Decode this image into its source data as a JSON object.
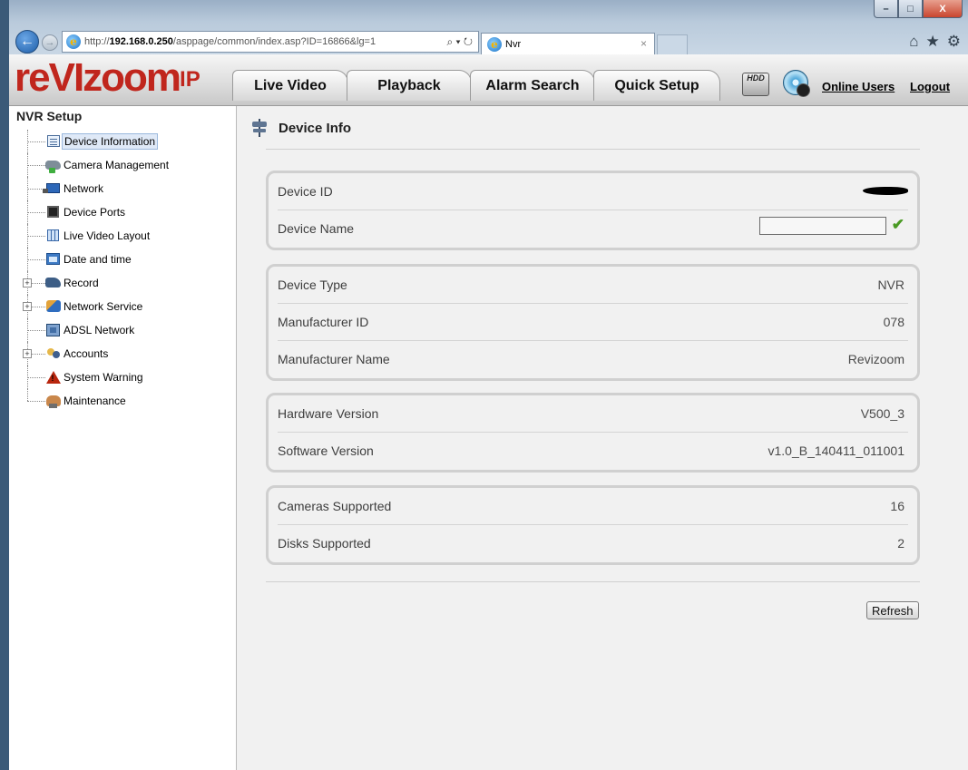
{
  "browser": {
    "url_scheme": "http://",
    "url_host": "192.168.0.250",
    "url_path": "/asppage/common/index.asp?ID=16866&lg=1",
    "addr_tools": "⌕ ▾ ↻",
    "tab_title": "Nvr",
    "tab_close": "×",
    "min_glyph": "–",
    "max_glyph": "□",
    "close_glyph": "X",
    "home_icon": "⌂",
    "star_icon": "★",
    "gear_icon": "⚙"
  },
  "app": {
    "logo_main": "reVIzoom",
    "logo_suffix": "IP",
    "tabs": [
      {
        "label": "Live Video"
      },
      {
        "label": "Playback"
      },
      {
        "label": "Alarm Search"
      },
      {
        "label": "Quick Setup"
      }
    ],
    "hdd_label": "HDD",
    "online_users": "Online Users",
    "logout": "Logout"
  },
  "sidebar": {
    "title": "NVR Setup",
    "items": [
      {
        "label": "Device Information",
        "icon": "document-icon",
        "selected": true
      },
      {
        "label": "Camera Management",
        "icon": "camera-icon"
      },
      {
        "label": "Network",
        "icon": "network-icon"
      },
      {
        "label": "Device Ports",
        "icon": "port-icon"
      },
      {
        "label": "Live Video Layout",
        "icon": "layout-icon"
      },
      {
        "label": "Date and time",
        "icon": "calendar-icon"
      },
      {
        "label": "Record",
        "icon": "record-icon",
        "expandable": true
      },
      {
        "label": "Network Service",
        "icon": "service-icon",
        "expandable": true
      },
      {
        "label": "ADSL Network",
        "icon": "adsl-icon"
      },
      {
        "label": "Accounts",
        "icon": "accounts-icon",
        "expandable": true
      },
      {
        "label": "System Warning",
        "icon": "warning-icon"
      },
      {
        "label": "Maintenance",
        "icon": "maintenance-icon"
      }
    ],
    "expander_glyph": "+"
  },
  "main": {
    "title": "Device Info",
    "groups": [
      {
        "rows": [
          {
            "label": "Device ID",
            "value": ""
          },
          {
            "label": "Device Name",
            "value": ""
          }
        ]
      },
      {
        "rows": [
          {
            "label": "Device Type",
            "value": "NVR"
          },
          {
            "label": "Manufacturer ID",
            "value": "078"
          },
          {
            "label": "Manufacturer Name",
            "value": "Revizoom"
          }
        ]
      },
      {
        "rows": [
          {
            "label": "Hardware Version",
            "value": "V500_3"
          },
          {
            "label": "Software Version",
            "value": "v1.0_B_140411_011001"
          }
        ]
      },
      {
        "rows": [
          {
            "label": "Cameras Supported",
            "value": "16"
          },
          {
            "label": "Disks Supported",
            "value": "2"
          }
        ]
      }
    ],
    "check_glyph": "✔",
    "refresh_label": "Refresh"
  },
  "colors": {
    "brand_red": "#c0261d",
    "panel_bg": "#f1f1f1",
    "selected_bg": "#dfe9f7",
    "check_green": "#4a9a24"
  }
}
